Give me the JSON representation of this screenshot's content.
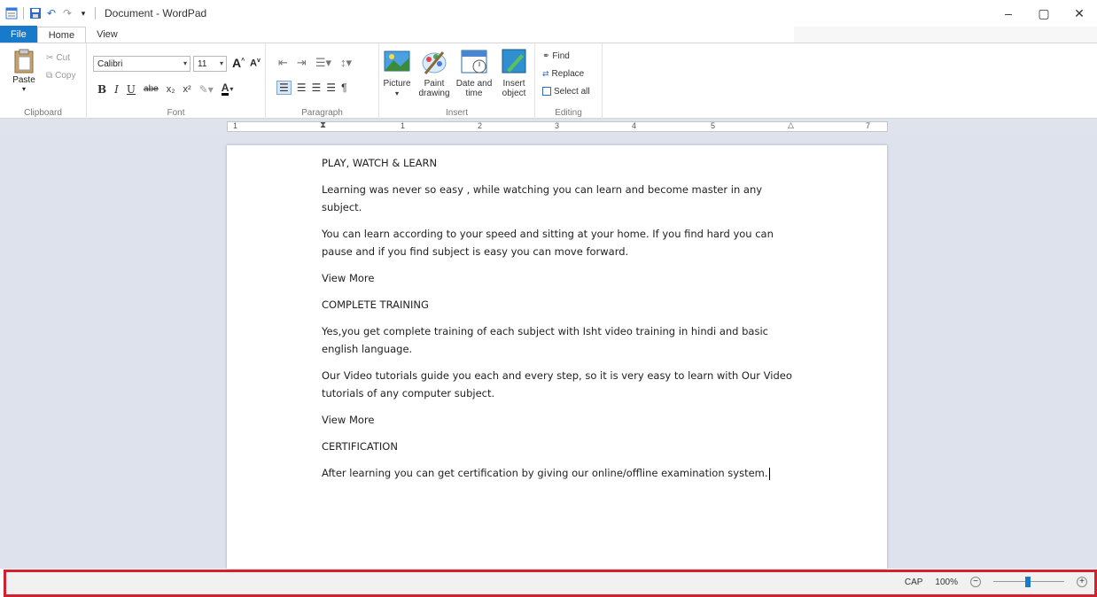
{
  "window": {
    "title": "Document - WordPad",
    "controls": {
      "minimize": "–",
      "restore": "▢",
      "close": "✕"
    }
  },
  "tabs": [
    {
      "label": "File"
    },
    {
      "label": "Home"
    },
    {
      "label": "View"
    }
  ],
  "ribbon": {
    "clipboard": {
      "paste": "Paste",
      "cut": "Cut",
      "copy": "Copy",
      "label": "Clipboard"
    },
    "font": {
      "family": "Calibri",
      "size": "11",
      "grow": "A",
      "shrink": "A",
      "bold": "B",
      "italic": "I",
      "underline": "U",
      "strike": "abe",
      "subscript": "x₂",
      "superscript": "x²",
      "label": "Font"
    },
    "paragraph": {
      "label": "Paragraph"
    },
    "insert": {
      "picture": "Picture",
      "paint": "Paint drawing",
      "datetime": "Date and time",
      "object": "Insert object",
      "label": "Insert"
    },
    "editing": {
      "find": "Find",
      "replace": "Replace",
      "select_all": "Select all",
      "label": "Editing"
    }
  },
  "ruler": {
    "numbers": [
      "1",
      "1",
      "2",
      "3",
      "4",
      "5",
      "7"
    ]
  },
  "document": {
    "paragraphs": [
      "PLAY, WATCH & LEARN",
      "Learning was never so easy , while watching you can learn and become master in any subject.",
      "You can learn according to your speed and sitting at your home. If you find hard you can pause and if you find subject is easy you can move forward.",
      "View More",
      "COMPLETE TRAINING",
      "Yes,you get complete training of each subject with Isht video training in hindi and basic english language.",
      "Our Video tutorials guide you each and every step, so it is very easy to learn with Our Video tutorials of any computer subject.",
      "View More",
      "CERTIFICATION",
      "After learning you can get certification by giving our online/offline examination system."
    ]
  },
  "statusbar": {
    "caps": "CAP",
    "zoom": "100%",
    "zoom_level": 1.0
  },
  "colors": {
    "accent": "#1979ca",
    "highlight_border": "#d2202e",
    "doc_background": "#dde2ec"
  }
}
